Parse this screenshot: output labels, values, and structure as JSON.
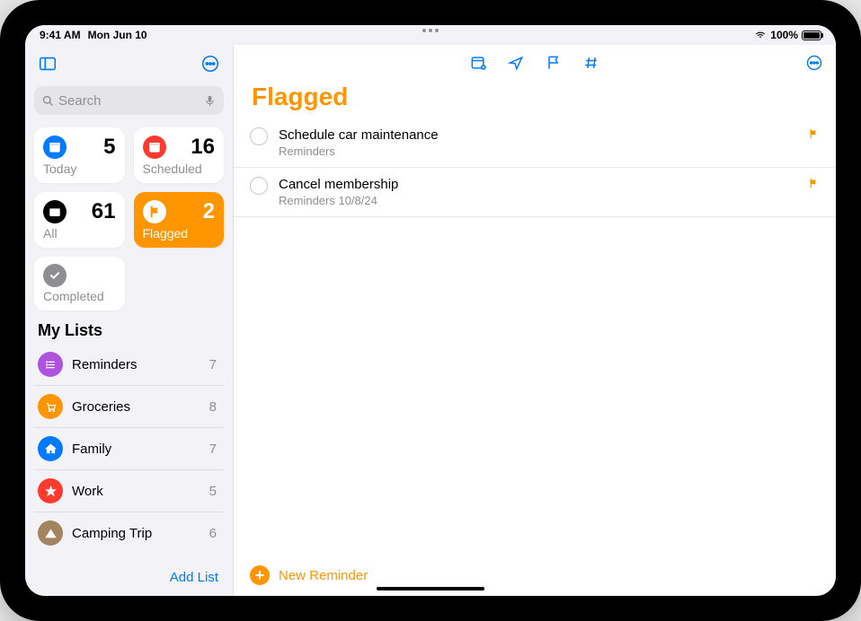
{
  "status": {
    "time": "9:41 AM",
    "date": "Mon Jun 10",
    "battery_pct": "100%"
  },
  "sidebar": {
    "search_placeholder": "Search",
    "smart_cards": [
      {
        "label": "Today",
        "count": "5",
        "color": "#007aff",
        "icon": "calendar",
        "selected": false
      },
      {
        "label": "Scheduled",
        "count": "16",
        "color": "#ff3b30",
        "icon": "calendar",
        "selected": false
      },
      {
        "label": "All",
        "count": "61",
        "color": "#000000",
        "icon": "tray",
        "selected": false
      },
      {
        "label": "Flagged",
        "count": "2",
        "color": "#ff9500",
        "icon": "flag",
        "selected": true
      },
      {
        "label": "Completed",
        "count": "",
        "color": "#8e8e93",
        "icon": "check",
        "selected": false
      }
    ],
    "section_header": "My Lists",
    "lists": [
      {
        "name": "Reminders",
        "count": "7",
        "color": "#af52de",
        "icon": "list"
      },
      {
        "name": "Groceries",
        "count": "8",
        "color": "#ff9500",
        "icon": "cart"
      },
      {
        "name": "Family",
        "count": "7",
        "color": "#007aff",
        "icon": "house"
      },
      {
        "name": "Work",
        "count": "5",
        "color": "#ff3b30",
        "icon": "star"
      },
      {
        "name": "Camping Trip",
        "count": "6",
        "color": "#a2845e",
        "icon": "tent"
      }
    ],
    "add_list_label": "Add List"
  },
  "main": {
    "title": "Flagged",
    "reminders": [
      {
        "title": "Schedule car maintenance",
        "subtitle": "Reminders",
        "flagged": true
      },
      {
        "title": "Cancel membership",
        "subtitle": "Reminders  10/8/24",
        "flagged": true
      }
    ],
    "new_reminder_label": "New Reminder"
  },
  "colors": {
    "accent_orange": "#ff9500",
    "system_blue": "#007aff"
  }
}
